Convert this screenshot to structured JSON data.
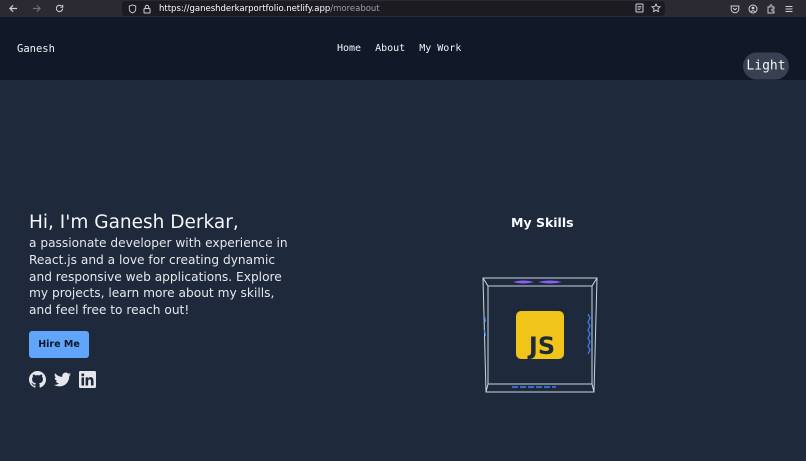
{
  "browser": {
    "url_host": "https://ganeshderkarportfolio.netlify.app",
    "url_path": "/moreabout",
    "icons": {
      "back": "arrow-left-icon",
      "forward": "arrow-right-icon",
      "reload": "reload-icon",
      "shield": "shield-icon",
      "lock": "lock-icon",
      "reader": "reader-view-icon",
      "bookmark": "star-icon",
      "pocket": "pocket-icon",
      "account": "account-icon",
      "extensions": "extensions-icon",
      "menu": "hamburger-menu-icon"
    }
  },
  "header": {
    "brand": "Ganesh",
    "nav": [
      "Home",
      "About",
      "My Work"
    ],
    "theme_toggle": "Light"
  },
  "hero": {
    "title": "Hi, I'm Ganesh Derkar,",
    "description": "a passionate developer with experience in React.js and a love for creating dynamic and responsive web applications. Explore my projects, learn more about my skills, and feel free to reach out!",
    "cta": "Hire Me",
    "socials": [
      "github-icon",
      "twitter-icon",
      "linkedin-icon"
    ]
  },
  "skills": {
    "title": "My Skills",
    "front_logo": "javascript-logo",
    "logo_text": "JS"
  },
  "colors": {
    "page_bg": "#1e293b",
    "header_bg": "#111827",
    "accent": "#60a5fa",
    "js_yellow": "#f0c419"
  }
}
